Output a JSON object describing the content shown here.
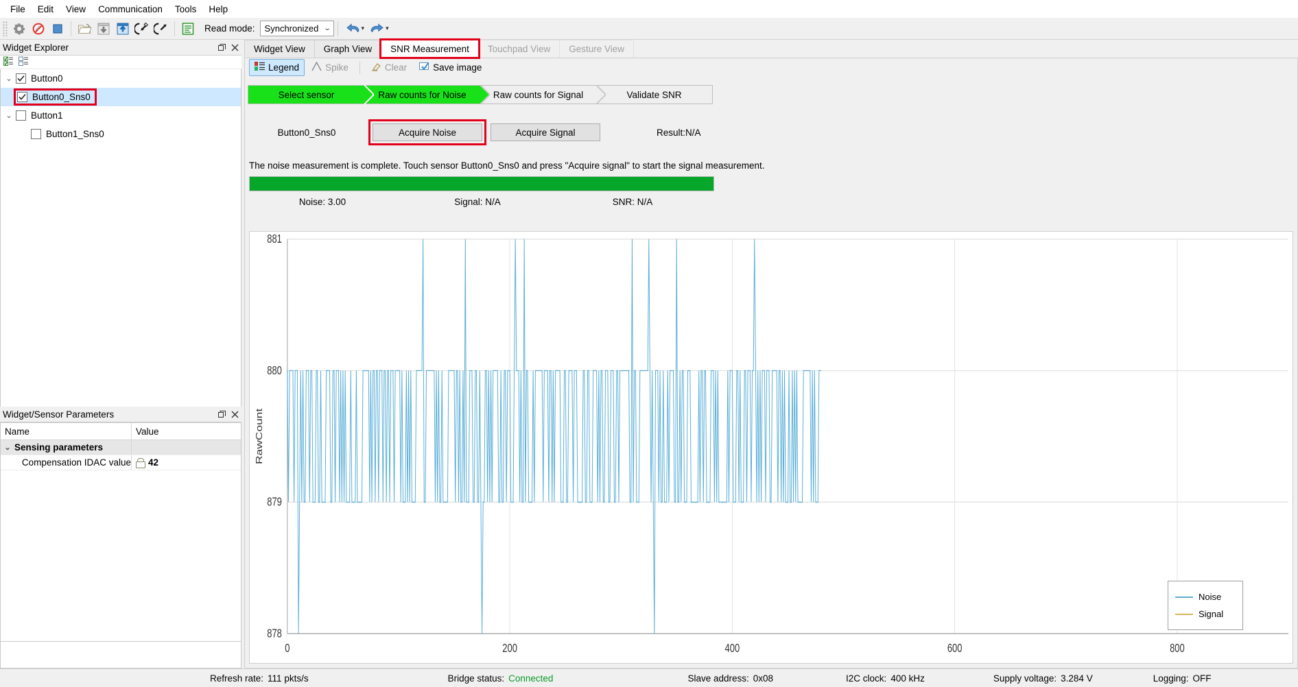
{
  "menu": {
    "items": [
      "File",
      "Edit",
      "View",
      "Communication",
      "Tools",
      "Help"
    ]
  },
  "toolbar": {
    "icons": [
      {
        "name": "settings-gear-icon"
      },
      {
        "name": "disconnect-icon"
      },
      {
        "name": "stop-icon"
      },
      {
        "name": "open-folder-icon"
      },
      {
        "name": "apply-to-device-icon"
      },
      {
        "name": "read-from-device-icon"
      },
      {
        "name": "import-icon"
      },
      {
        "name": "export-icon"
      },
      {
        "name": "log-icon"
      }
    ],
    "read_mode_label": "Read mode:",
    "read_mode_value": "Synchronized",
    "undo_label": "Undo",
    "redo_label": "Redo"
  },
  "widget_explorer": {
    "title": "Widget Explorer",
    "float_icon": "restore-icon",
    "close_icon": "close-icon",
    "toolbar_icons": [
      "check-all-icon",
      "uncheck-all-icon"
    ],
    "tree": [
      {
        "label": "Button0",
        "checked": true,
        "level": 0,
        "expanded": true,
        "selected": false,
        "highlighted": false
      },
      {
        "label": "Button0_Sns0",
        "checked": true,
        "level": 1,
        "expanded": false,
        "selected": true,
        "highlighted": true
      },
      {
        "label": "Button1",
        "checked": false,
        "level": 0,
        "expanded": true,
        "selected": false,
        "highlighted": false
      },
      {
        "label": "Button1_Sns0",
        "checked": false,
        "level": 1,
        "expanded": false,
        "selected": false,
        "highlighted": false
      }
    ]
  },
  "parameters": {
    "title": "Widget/Sensor Parameters",
    "float_icon": "restore-icon",
    "close_icon": "close-icon",
    "columns": [
      "Name",
      "Value"
    ],
    "rows": [
      {
        "type": "group",
        "name": "Sensing parameters",
        "value": ""
      },
      {
        "type": "item",
        "name": "Compensation IDAC value",
        "value": "42",
        "locked": true
      }
    ]
  },
  "tabs": [
    {
      "label": "Widget View",
      "state": "normal"
    },
    {
      "label": "Graph View",
      "state": "normal"
    },
    {
      "label": "SNR Measurement",
      "state": "active-highlighted"
    },
    {
      "label": "Touchpad View",
      "state": "disabled"
    },
    {
      "label": "Gesture View",
      "state": "disabled"
    }
  ],
  "chart_toolbar": [
    {
      "label": "Legend",
      "icon": "legend-icon",
      "active": true,
      "disabled": false
    },
    {
      "label": "Spike",
      "icon": "spike-icon",
      "active": false,
      "disabled": true
    },
    {
      "label": "Clear",
      "icon": "eraser-icon",
      "active": false,
      "disabled": true
    },
    {
      "label": "Save image",
      "icon": "save-image-icon",
      "active": false,
      "disabled": false
    }
  ],
  "workflow": {
    "steps": [
      {
        "label": "Select sensor",
        "done": true
      },
      {
        "label": "Raw counts for Noise",
        "done": true
      },
      {
        "label": "Raw counts for Signal",
        "done": false
      },
      {
        "label": "Validate SNR",
        "done": false
      }
    ],
    "done_color": "#19e119"
  },
  "actions": {
    "sensor_name": "Button0_Sns0",
    "acquire_noise_label": "Acquire Noise",
    "acquire_signal_label": "Acquire Signal",
    "result_label": "Result:N/A",
    "highlight_color": "#e2001a"
  },
  "status_message": "The noise measurement is complete. Touch sensor Button0_Sns0 and press \"Acquire signal\" to start the signal measurement.",
  "progress": {
    "percent": 100,
    "color": "#06a62a"
  },
  "readouts": [
    {
      "label": "Noise:",
      "value": "3.00"
    },
    {
      "label": "Signal:",
      "value": "N/A"
    },
    {
      "label": "SNR:",
      "value": "N/A"
    }
  ],
  "chart_data": {
    "type": "line",
    "title": "",
    "xlabel": "",
    "ylabel": "RawCount",
    "xlim": [
      0,
      900
    ],
    "ylim": [
      878,
      881
    ],
    "xticks": [
      0,
      200,
      400,
      600,
      800
    ],
    "yticks": [
      878,
      879,
      880,
      881
    ],
    "grid": true,
    "legend_position": "bottom-right",
    "series": [
      {
        "name": "Noise",
        "color": "#5bafd8",
        "baseline": 880,
        "n_points": 480,
        "spikes_up": [
          122,
          160,
          205,
          213,
          310,
          325,
          350,
          420
        ],
        "spikes_down": [
          10,
          175,
          330
        ],
        "description": "Dense noise trace oscillating between 879 and 880 with occasional spikes to 881 and dips to 878"
      },
      {
        "name": "Signal",
        "color": "#d8b55b",
        "values": [],
        "description": "No signal data acquired yet"
      }
    ]
  },
  "statusbar": [
    {
      "label": "Refresh rate:",
      "value": "111 pkts/s",
      "color": "normal"
    },
    {
      "label": "Bridge status:",
      "value": "Connected",
      "color": "green"
    },
    {
      "label": "Slave address:",
      "value": "0x08",
      "color": "normal"
    },
    {
      "label": "I2C clock:",
      "value": "400 kHz",
      "color": "normal"
    },
    {
      "label": "Supply voltage:",
      "value": "3.284 V",
      "color": "normal"
    },
    {
      "label": "Logging:",
      "value": "OFF",
      "color": "normal"
    }
  ]
}
